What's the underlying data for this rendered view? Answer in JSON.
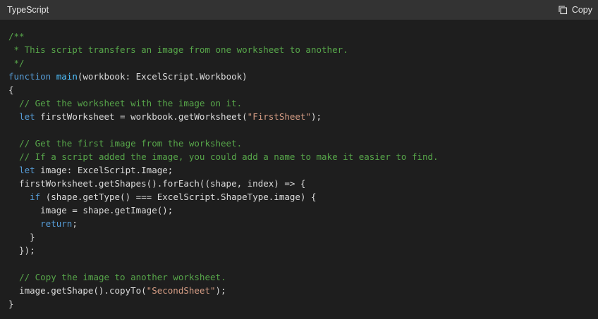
{
  "header": {
    "language": "TypeScript",
    "copy_label": "Copy",
    "copy_icon": "copy-icon"
  },
  "colors": {
    "background": "#1e1e1e",
    "header": "#333333",
    "comment": "#57a64a",
    "keyword": "#569cd6",
    "function": "#4fc1ff",
    "string": "#d69d85",
    "text": "#dcdcdc"
  },
  "code": [
    [
      {
        "t": "c",
        "v": "/**"
      }
    ],
    [
      {
        "t": "c",
        "v": " * This script transfers an image from one worksheet to another."
      }
    ],
    [
      {
        "t": "c",
        "v": " */"
      }
    ],
    [
      {
        "t": "k",
        "v": "function"
      },
      {
        "t": "p",
        "v": " "
      },
      {
        "t": "f",
        "v": "main"
      },
      {
        "t": "p",
        "v": "(workbook: ExcelScript.Workbook)"
      }
    ],
    [
      {
        "t": "p",
        "v": "{"
      }
    ],
    [
      {
        "t": "p",
        "v": "  "
      },
      {
        "t": "c",
        "v": "// Get the worksheet with the image on it."
      }
    ],
    [
      {
        "t": "p",
        "v": "  "
      },
      {
        "t": "k",
        "v": "let"
      },
      {
        "t": "p",
        "v": " firstWorksheet = workbook.getWorksheet("
      },
      {
        "t": "s",
        "v": "\"FirstSheet\""
      },
      {
        "t": "p",
        "v": ");"
      }
    ],
    [
      {
        "t": "p",
        "v": ""
      }
    ],
    [
      {
        "t": "p",
        "v": "  "
      },
      {
        "t": "c",
        "v": "// Get the first image from the worksheet."
      }
    ],
    [
      {
        "t": "p",
        "v": "  "
      },
      {
        "t": "c",
        "v": "// If a script added the image, you could add a name to make it easier to find."
      }
    ],
    [
      {
        "t": "p",
        "v": "  "
      },
      {
        "t": "k",
        "v": "let"
      },
      {
        "t": "p",
        "v": " image: ExcelScript.Image;"
      }
    ],
    [
      {
        "t": "p",
        "v": "  firstWorksheet.getShapes().forEach((shape, index) => {"
      }
    ],
    [
      {
        "t": "p",
        "v": "    "
      },
      {
        "t": "k",
        "v": "if"
      },
      {
        "t": "p",
        "v": " (shape.getType() === ExcelScript.ShapeType.image) {"
      }
    ],
    [
      {
        "t": "p",
        "v": "      image = shape.getImage();"
      }
    ],
    [
      {
        "t": "p",
        "v": "      "
      },
      {
        "t": "k",
        "v": "return"
      },
      {
        "t": "p",
        "v": ";"
      }
    ],
    [
      {
        "t": "p",
        "v": "    }"
      }
    ],
    [
      {
        "t": "p",
        "v": "  });"
      }
    ],
    [
      {
        "t": "p",
        "v": ""
      }
    ],
    [
      {
        "t": "p",
        "v": "  "
      },
      {
        "t": "c",
        "v": "// Copy the image to another worksheet."
      }
    ],
    [
      {
        "t": "p",
        "v": "  image.getShape().copyTo("
      },
      {
        "t": "s",
        "v": "\"SecondSheet\""
      },
      {
        "t": "p",
        "v": ");"
      }
    ],
    [
      {
        "t": "p",
        "v": "}"
      }
    ]
  ]
}
